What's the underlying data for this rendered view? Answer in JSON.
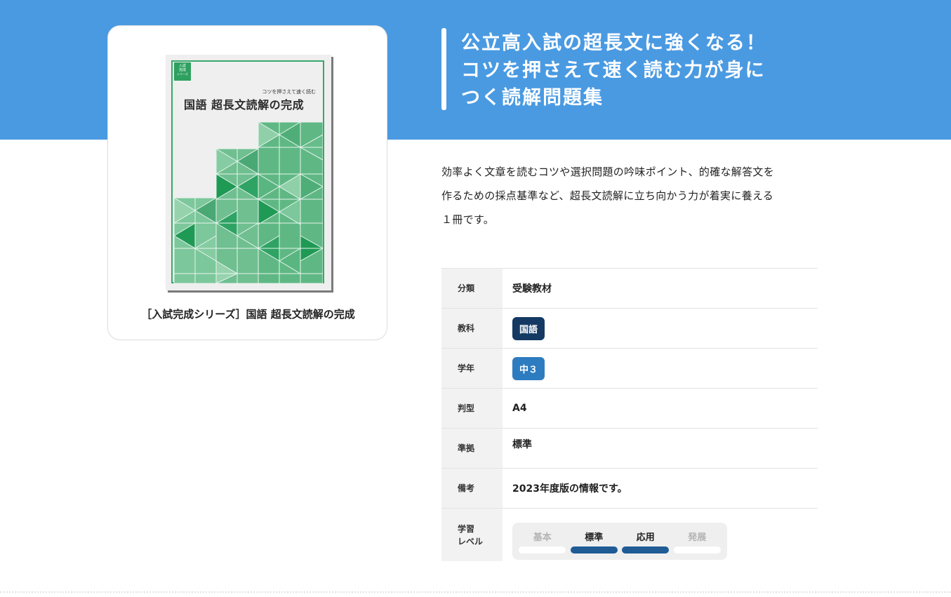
{
  "headline": {
    "line1": "公立高入試の超長文に強くなる！",
    "line2": "コツを押さえて速く読む力が身に",
    "line3": "つく読解問題集"
  },
  "description": {
    "line1": "効率よく文章を読むコツや選択問題の吟味ポイント、的確な解答文を",
    "line2": "作るための採点基準など、超長文読解に立ち向かう力が着実に養える",
    "line3": "１冊です。"
  },
  "book": {
    "caption": "［入試完成シリーズ］国語 超長文読解の完成",
    "cover_badge_line1": "入試",
    "cover_badge_line2": "完成",
    "cover_badge_line3": "シリーズ",
    "cover_subtitle": "コツを押さえて速く読む",
    "cover_title": "国語 超長文読解の完成"
  },
  "specs": {
    "category_label": "分類",
    "category_value": "受験教材",
    "subject_label": "教科",
    "subject_value": "国語",
    "grade_label": "学年",
    "grade_value": "中３",
    "size_label": "判型",
    "size_value": "A4",
    "standard_label": "準拠",
    "standard_value": "標準",
    "note_label": "備考",
    "note_value": "2023年度版の情報です。",
    "level_label_line1": "学習",
    "level_label_line2": "レベル"
  },
  "levels": [
    {
      "label": "基本",
      "active": false
    },
    {
      "label": "標準",
      "active": true
    },
    {
      "label": "応用",
      "active": true
    },
    {
      "label": "発展",
      "active": false
    }
  ],
  "colors": {
    "hero_blue": "#4a9ae2",
    "subject_tag": "#143a63",
    "grade_tag": "#2e7cc0",
    "level_active": "#1f5c96",
    "cover_green": "#38a86a"
  }
}
